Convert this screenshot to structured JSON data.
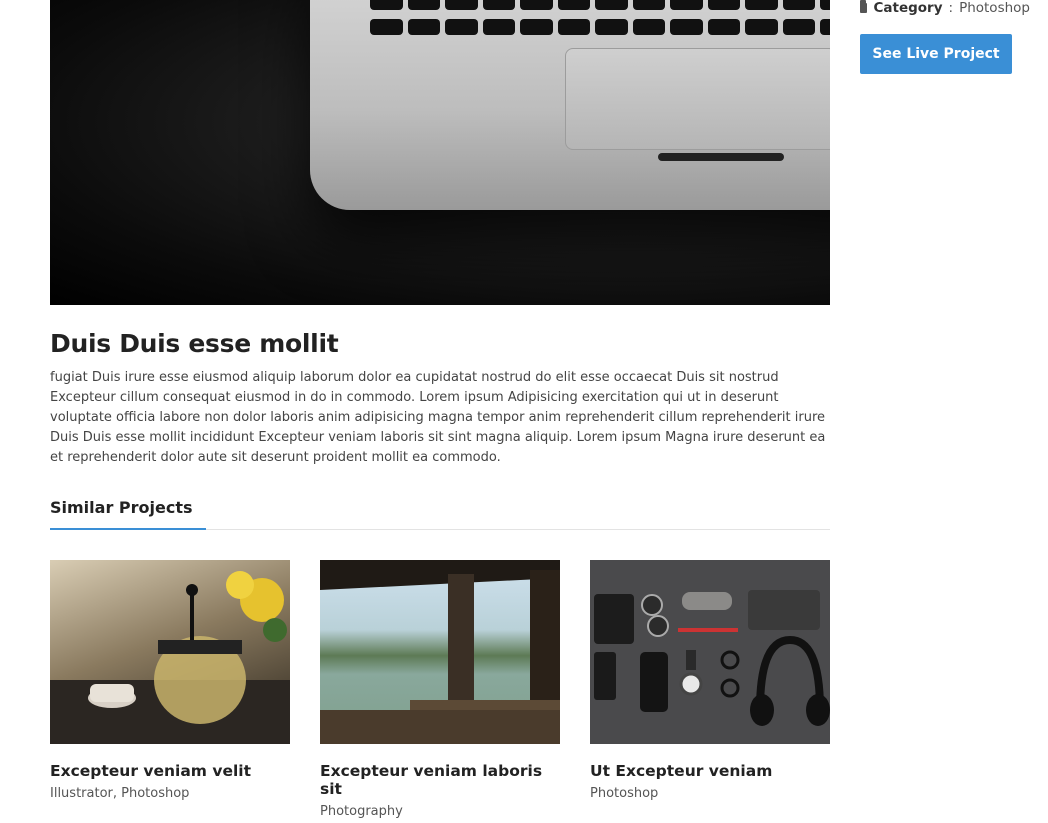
{
  "project": {
    "title": "Duis Duis esse mollit",
    "description": "fugiat Duis irure esse eiusmod aliquip laborum dolor ea cupidatat nostrud do elit esse occaecat Duis sit nostrud Excepteur cillum consequat eiusmod in do in commodo. Lorem ipsum Adipisicing exercitation qui ut in deserunt voluptate officia labore non dolor laboris anim adipisicing magna tempor anim reprehenderit cillum reprehenderit irure Duis Duis esse mollit incididunt Excepteur veniam laboris sit sint magna aliquip. Lorem ipsum Magna irure deserunt ea et reprehenderit dolor aute sit deserunt proident mollit ea commodo."
  },
  "sidebar": {
    "category_label": "Category",
    "category_value": "Photoshop",
    "live_button": "See Live Project"
  },
  "similar": {
    "heading": "Similar Projects",
    "items": [
      {
        "title": "Excepteur veniam velit",
        "categories": "Illustrator, Photoshop"
      },
      {
        "title": "Excepteur veniam laboris sit",
        "categories": "Photography"
      },
      {
        "title": "Ut Excepteur veniam",
        "categories": "Photoshop"
      }
    ]
  },
  "colors": {
    "accent": "#3a8fd6"
  }
}
